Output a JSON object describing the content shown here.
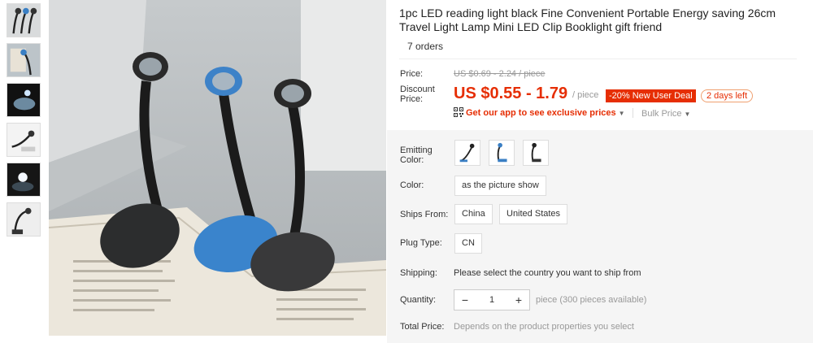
{
  "product": {
    "title": "1pc LED reading light black Fine Convenient Portable Energy saving 26cm Travel Light Lamp Mini LED Clip Booklight gift friend",
    "orders": "7 orders"
  },
  "price": {
    "label": "Price:",
    "original": "US $0.69 - 2.24 / piece",
    "discount_label": "Discount Price:",
    "discount": "US $0.55 - 1.79",
    "per_piece": "/ piece",
    "deal_badge": "-20% New User Deal",
    "days_badge": "2 days left",
    "app_text": "Get our app to see exclusive prices",
    "bulk_text": "Bulk Price",
    "accent_color": "#e62e04"
  },
  "properties": {
    "emitting_color_label": "Emitting Color:",
    "emitting_color_options": [
      "black lamp 1",
      "blue lamp",
      "black lamp 2"
    ],
    "color_label": "Color:",
    "color_option": "as the picture show",
    "ships_from_label": "Ships From:",
    "ships_from_options": [
      "China",
      "United States"
    ],
    "plug_type_label": "Plug Type:",
    "plug_type_option": "CN",
    "shipping_label": "Shipping:",
    "shipping_text": "Please select the country you want to ship from",
    "quantity_label": "Quantity:",
    "quantity_value": "1",
    "quantity_minus": "−",
    "quantity_plus": "+",
    "quantity_note": "piece (300 pieces available)",
    "total_label": "Total Price:",
    "total_text": "Depends on the product properties you select"
  },
  "icons": {
    "qr": "qr-code-icon",
    "caret": "caret-down-icon"
  }
}
